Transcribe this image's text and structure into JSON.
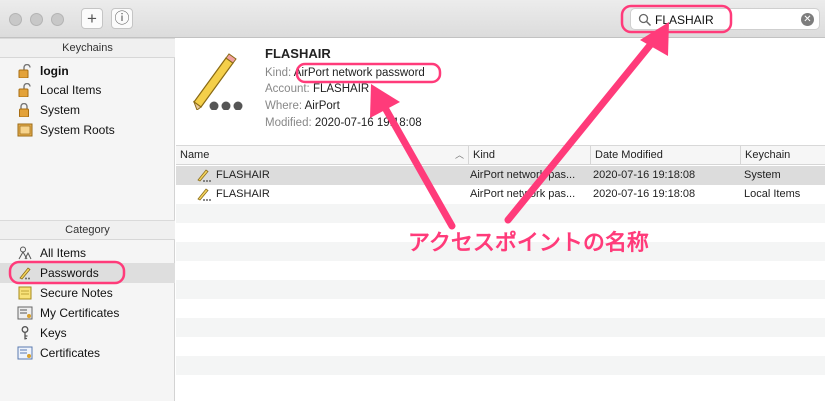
{
  "colors": {
    "annotation": "#ff3b7a"
  },
  "toolbar": {
    "add_icon": "+",
    "info_icon": "ⓘ",
    "search_value": "FLASHAIR"
  },
  "sidebar": {
    "keychains_header": "Keychains",
    "keychains": [
      {
        "label": "login",
        "icon": "lock-open-icon"
      },
      {
        "label": "Local Items",
        "icon": "lock-open-icon"
      },
      {
        "label": "System",
        "icon": "lock-icon"
      },
      {
        "label": "System Roots",
        "icon": "cabinet-icon"
      }
    ],
    "category_header": "Category",
    "categories": [
      {
        "label": "All Items",
        "icon": "people-icon"
      },
      {
        "label": "Passwords",
        "icon": "pencil-icon"
      },
      {
        "label": "Secure Notes",
        "icon": "note-icon"
      },
      {
        "label": "My Certificates",
        "icon": "certificate-icon"
      },
      {
        "label": "Keys",
        "icon": "key-icon"
      },
      {
        "label": "Certificates",
        "icon": "certificate-icon"
      }
    ]
  },
  "detail": {
    "title": "FLASHAIR",
    "kind_label": "Kind:",
    "kind_value": "AirPort network password",
    "account_label": "Account:",
    "account_value": "FLASHAIR",
    "where_label": "Where:",
    "where_value": "AirPort",
    "modified_label": "Modified:",
    "modified_value": "2020-07-16 19:18:08"
  },
  "table": {
    "columns": [
      "Name",
      "Kind",
      "Date Modified",
      "Keychain"
    ],
    "rows": [
      {
        "name": "FLASHAIR",
        "kind": "AirPort network pas...",
        "date": "2020-07-16 19:18:08",
        "keychain": "System"
      },
      {
        "name": "FLASHAIR",
        "kind": "AirPort network pas...",
        "date": "2020-07-16 19:18:08",
        "keychain": "Local Items"
      }
    ]
  },
  "annotation": {
    "text": "アクセスポイントの名称"
  }
}
